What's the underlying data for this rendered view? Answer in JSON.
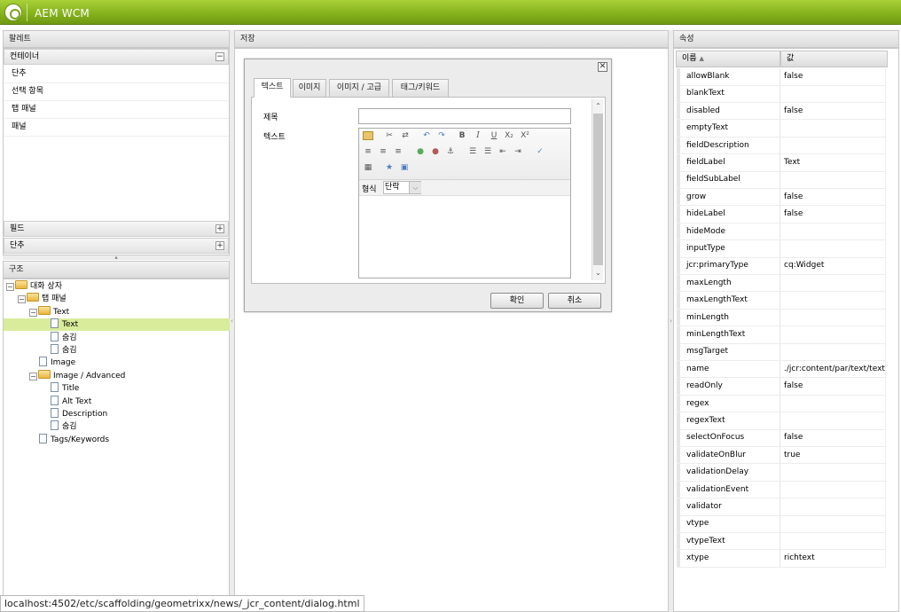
{
  "app": {
    "title": "AEM WCM"
  },
  "palette": {
    "header": "팔레트",
    "container_header": "컨테이너",
    "container_items": [
      "단추",
      "선택 항목",
      "탭 패널",
      "패널"
    ],
    "fields_header": "필드",
    "buttons_header": "단추"
  },
  "structure": {
    "header": "구조",
    "nodes": [
      {
        "label": "대화 상자",
        "kind": "folder",
        "level": 0,
        "toggle": "−"
      },
      {
        "label": "탭 패널",
        "kind": "folder",
        "level": 1,
        "toggle": "−"
      },
      {
        "label": "Text",
        "kind": "folder",
        "level": 2,
        "toggle": "−"
      },
      {
        "label": "Text",
        "kind": "doc",
        "level": 3,
        "toggle": "",
        "selected": true
      },
      {
        "label": "숨김",
        "kind": "doc",
        "level": 3,
        "toggle": ""
      },
      {
        "label": "숨김",
        "kind": "doc",
        "level": 3,
        "toggle": ""
      },
      {
        "label": "Image",
        "kind": "doc",
        "level": 2,
        "toggle": ""
      },
      {
        "label": "Image / Advanced",
        "kind": "folder",
        "level": 2,
        "toggle": "−"
      },
      {
        "label": "Title",
        "kind": "doc",
        "level": 3,
        "toggle": ""
      },
      {
        "label": "Alt Text",
        "kind": "doc",
        "level": 3,
        "toggle": ""
      },
      {
        "label": "Description",
        "kind": "doc",
        "level": 3,
        "toggle": ""
      },
      {
        "label": "숨김",
        "kind": "doc",
        "level": 3,
        "toggle": ""
      },
      {
        "label": "Tags/Keywords",
        "kind": "doc",
        "level": 2,
        "toggle": ""
      }
    ]
  },
  "center": {
    "header": "저장"
  },
  "dialog": {
    "tabs": [
      "텍스트",
      "이미지",
      "이미지 / 고급",
      "태그/키워드"
    ],
    "active_tab": 0,
    "title_label": "제목",
    "text_label": "텍스트",
    "title_value": "",
    "format_label": "형식",
    "format_value": "단락",
    "ok_label": "확인",
    "cancel_label": "취소",
    "close_icon": "close-icon"
  },
  "properties": {
    "header": "속성",
    "col_name": "이름",
    "col_value": "값",
    "rows": [
      {
        "name": "allowBlank",
        "value": "false"
      },
      {
        "name": "blankText",
        "value": ""
      },
      {
        "name": "disabled",
        "value": "false"
      },
      {
        "name": "emptyText",
        "value": ""
      },
      {
        "name": "fieldDescription",
        "value": ""
      },
      {
        "name": "fieldLabel",
        "value": "Text"
      },
      {
        "name": "fieldSubLabel",
        "value": ""
      },
      {
        "name": "grow",
        "value": "false"
      },
      {
        "name": "hideLabel",
        "value": "false"
      },
      {
        "name": "hideMode",
        "value": ""
      },
      {
        "name": "inputType",
        "value": ""
      },
      {
        "name": "jcr:primaryType",
        "value": "cq:Widget"
      },
      {
        "name": "maxLength",
        "value": ""
      },
      {
        "name": "maxLengthText",
        "value": ""
      },
      {
        "name": "minLength",
        "value": ""
      },
      {
        "name": "minLengthText",
        "value": ""
      },
      {
        "name": "msgTarget",
        "value": ""
      },
      {
        "name": "name",
        "value": "./jcr:content/par/text/text"
      },
      {
        "name": "readOnly",
        "value": "false"
      },
      {
        "name": "regex",
        "value": ""
      },
      {
        "name": "regexText",
        "value": ""
      },
      {
        "name": "selectOnFocus",
        "value": "false"
      },
      {
        "name": "validateOnBlur",
        "value": "true"
      },
      {
        "name": "validationDelay",
        "value": ""
      },
      {
        "name": "validationEvent",
        "value": ""
      },
      {
        "name": "validator",
        "value": ""
      },
      {
        "name": "vtype",
        "value": ""
      },
      {
        "name": "vtypeText",
        "value": ""
      },
      {
        "name": "xtype",
        "value": "richtext"
      }
    ]
  },
  "status": {
    "url": "localhost:4502/etc/scaffolding/geometrixx/news/_jcr_content/dialog.html"
  },
  "colors": {
    "accent": "#8cb823",
    "selection": "#d9ec9b"
  }
}
